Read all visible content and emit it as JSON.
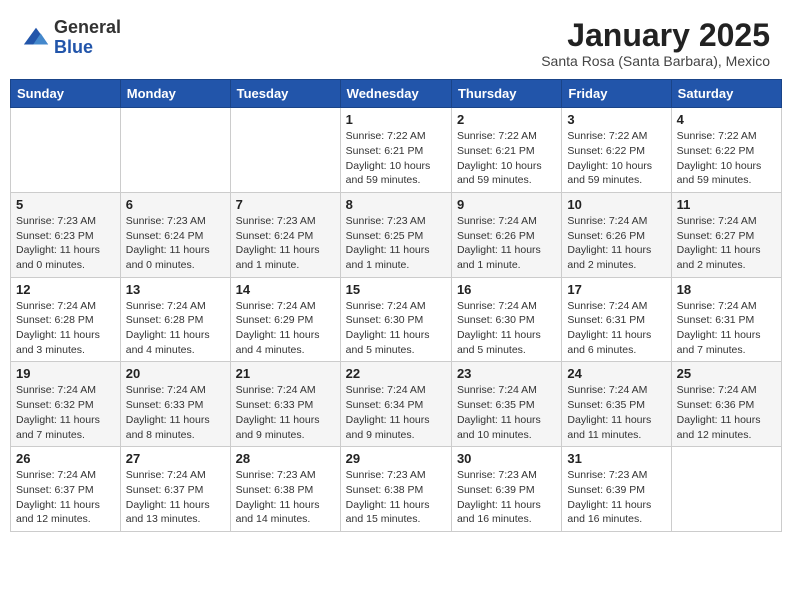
{
  "logo": {
    "general": "General",
    "blue": "Blue"
  },
  "title": "January 2025",
  "subtitle": "Santa Rosa (Santa Barbara), Mexico",
  "days_of_week": [
    "Sunday",
    "Monday",
    "Tuesday",
    "Wednesday",
    "Thursday",
    "Friday",
    "Saturday"
  ],
  "weeks": [
    [
      {
        "day": "",
        "info": ""
      },
      {
        "day": "",
        "info": ""
      },
      {
        "day": "",
        "info": ""
      },
      {
        "day": "1",
        "info": "Sunrise: 7:22 AM\nSunset: 6:21 PM\nDaylight: 10 hours and 59 minutes."
      },
      {
        "day": "2",
        "info": "Sunrise: 7:22 AM\nSunset: 6:21 PM\nDaylight: 10 hours and 59 minutes."
      },
      {
        "day": "3",
        "info": "Sunrise: 7:22 AM\nSunset: 6:22 PM\nDaylight: 10 hours and 59 minutes."
      },
      {
        "day": "4",
        "info": "Sunrise: 7:22 AM\nSunset: 6:22 PM\nDaylight: 10 hours and 59 minutes."
      }
    ],
    [
      {
        "day": "5",
        "info": "Sunrise: 7:23 AM\nSunset: 6:23 PM\nDaylight: 11 hours and 0 minutes."
      },
      {
        "day": "6",
        "info": "Sunrise: 7:23 AM\nSunset: 6:24 PM\nDaylight: 11 hours and 0 minutes."
      },
      {
        "day": "7",
        "info": "Sunrise: 7:23 AM\nSunset: 6:24 PM\nDaylight: 11 hours and 1 minute."
      },
      {
        "day": "8",
        "info": "Sunrise: 7:23 AM\nSunset: 6:25 PM\nDaylight: 11 hours and 1 minute."
      },
      {
        "day": "9",
        "info": "Sunrise: 7:24 AM\nSunset: 6:26 PM\nDaylight: 11 hours and 1 minute."
      },
      {
        "day": "10",
        "info": "Sunrise: 7:24 AM\nSunset: 6:26 PM\nDaylight: 11 hours and 2 minutes."
      },
      {
        "day": "11",
        "info": "Sunrise: 7:24 AM\nSunset: 6:27 PM\nDaylight: 11 hours and 2 minutes."
      }
    ],
    [
      {
        "day": "12",
        "info": "Sunrise: 7:24 AM\nSunset: 6:28 PM\nDaylight: 11 hours and 3 minutes."
      },
      {
        "day": "13",
        "info": "Sunrise: 7:24 AM\nSunset: 6:28 PM\nDaylight: 11 hours and 4 minutes."
      },
      {
        "day": "14",
        "info": "Sunrise: 7:24 AM\nSunset: 6:29 PM\nDaylight: 11 hours and 4 minutes."
      },
      {
        "day": "15",
        "info": "Sunrise: 7:24 AM\nSunset: 6:30 PM\nDaylight: 11 hours and 5 minutes."
      },
      {
        "day": "16",
        "info": "Sunrise: 7:24 AM\nSunset: 6:30 PM\nDaylight: 11 hours and 5 minutes."
      },
      {
        "day": "17",
        "info": "Sunrise: 7:24 AM\nSunset: 6:31 PM\nDaylight: 11 hours and 6 minutes."
      },
      {
        "day": "18",
        "info": "Sunrise: 7:24 AM\nSunset: 6:31 PM\nDaylight: 11 hours and 7 minutes."
      }
    ],
    [
      {
        "day": "19",
        "info": "Sunrise: 7:24 AM\nSunset: 6:32 PM\nDaylight: 11 hours and 7 minutes."
      },
      {
        "day": "20",
        "info": "Sunrise: 7:24 AM\nSunset: 6:33 PM\nDaylight: 11 hours and 8 minutes."
      },
      {
        "day": "21",
        "info": "Sunrise: 7:24 AM\nSunset: 6:33 PM\nDaylight: 11 hours and 9 minutes."
      },
      {
        "day": "22",
        "info": "Sunrise: 7:24 AM\nSunset: 6:34 PM\nDaylight: 11 hours and 9 minutes."
      },
      {
        "day": "23",
        "info": "Sunrise: 7:24 AM\nSunset: 6:35 PM\nDaylight: 11 hours and 10 minutes."
      },
      {
        "day": "24",
        "info": "Sunrise: 7:24 AM\nSunset: 6:35 PM\nDaylight: 11 hours and 11 minutes."
      },
      {
        "day": "25",
        "info": "Sunrise: 7:24 AM\nSunset: 6:36 PM\nDaylight: 11 hours and 12 minutes."
      }
    ],
    [
      {
        "day": "26",
        "info": "Sunrise: 7:24 AM\nSunset: 6:37 PM\nDaylight: 11 hours and 12 minutes."
      },
      {
        "day": "27",
        "info": "Sunrise: 7:24 AM\nSunset: 6:37 PM\nDaylight: 11 hours and 13 minutes."
      },
      {
        "day": "28",
        "info": "Sunrise: 7:23 AM\nSunset: 6:38 PM\nDaylight: 11 hours and 14 minutes."
      },
      {
        "day": "29",
        "info": "Sunrise: 7:23 AM\nSunset: 6:38 PM\nDaylight: 11 hours and 15 minutes."
      },
      {
        "day": "30",
        "info": "Sunrise: 7:23 AM\nSunset: 6:39 PM\nDaylight: 11 hours and 16 minutes."
      },
      {
        "day": "31",
        "info": "Sunrise: 7:23 AM\nSunset: 6:39 PM\nDaylight: 11 hours and 16 minutes."
      },
      {
        "day": "",
        "info": ""
      }
    ]
  ],
  "colors": {
    "header_bg": "#2255aa",
    "header_text": "#ffffff",
    "border": "#cccccc"
  }
}
